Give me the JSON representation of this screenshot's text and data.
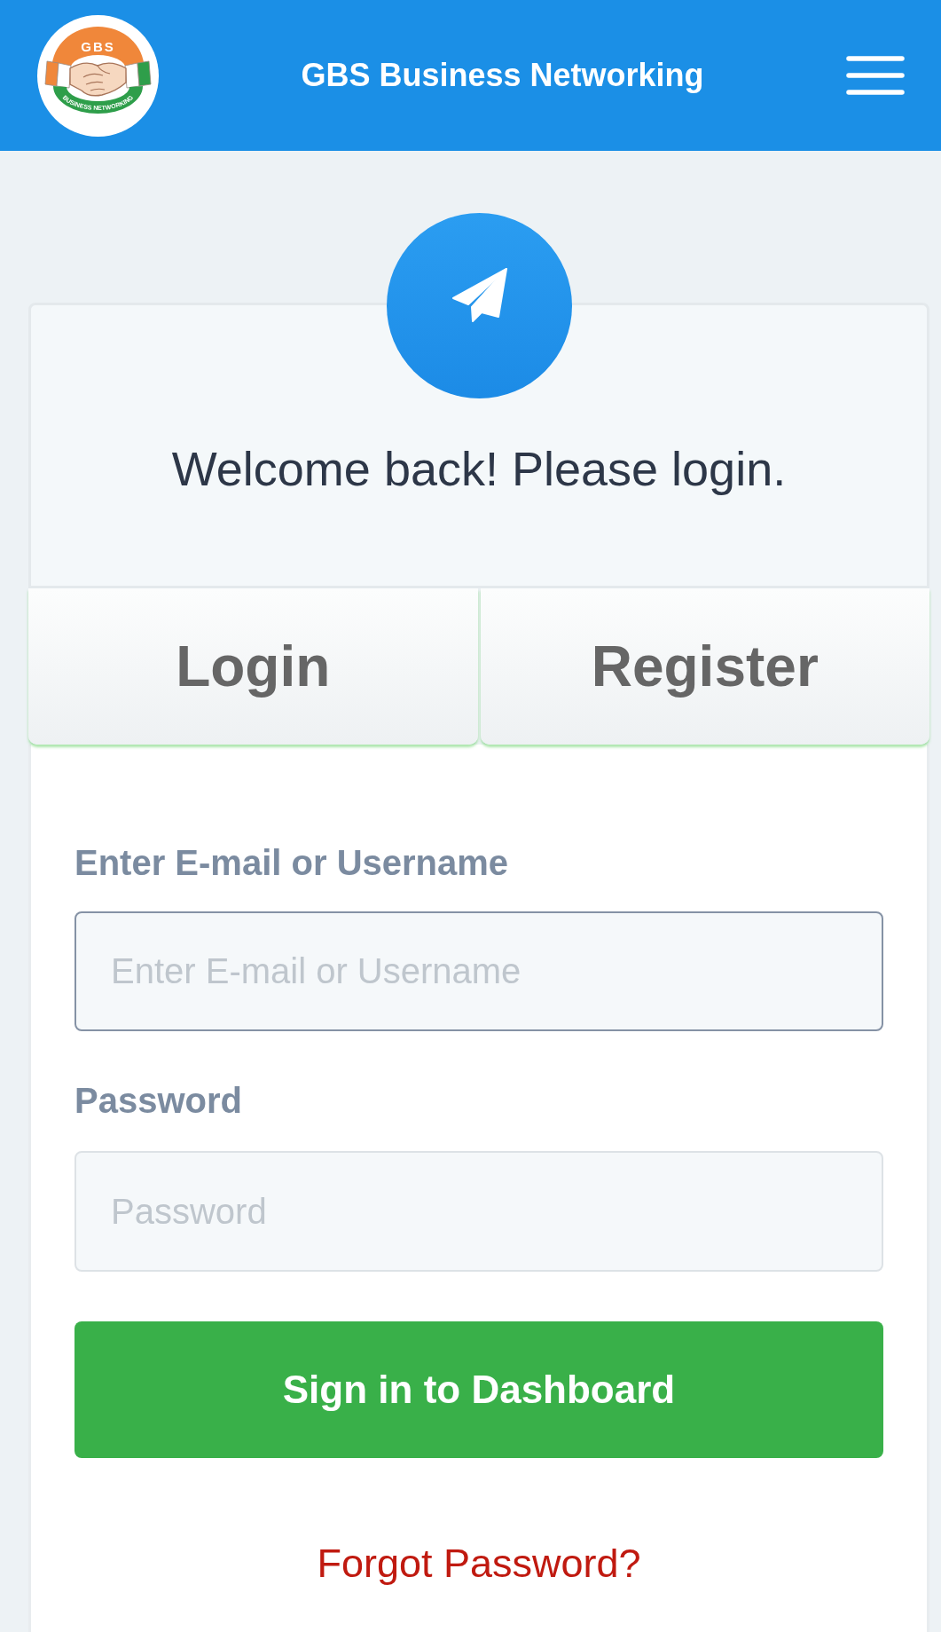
{
  "header": {
    "logo": {
      "initials": "GBS",
      "tagline": "BUSINESS NETWORKING"
    },
    "title": "GBS Business Networking"
  },
  "card": {
    "greeting": "Welcome back! Please login.",
    "tabs": [
      {
        "label": "Login"
      },
      {
        "label": "Register"
      }
    ],
    "fields": [
      {
        "label": "Enter E-mail or Username",
        "placeholder": "Enter E-mail or Username",
        "focused": true
      },
      {
        "label": "Password",
        "placeholder": "Password",
        "focused": false
      }
    ],
    "submit_button": "Sign in to Dashboard",
    "forgot_link": "Forgot Password?"
  }
}
